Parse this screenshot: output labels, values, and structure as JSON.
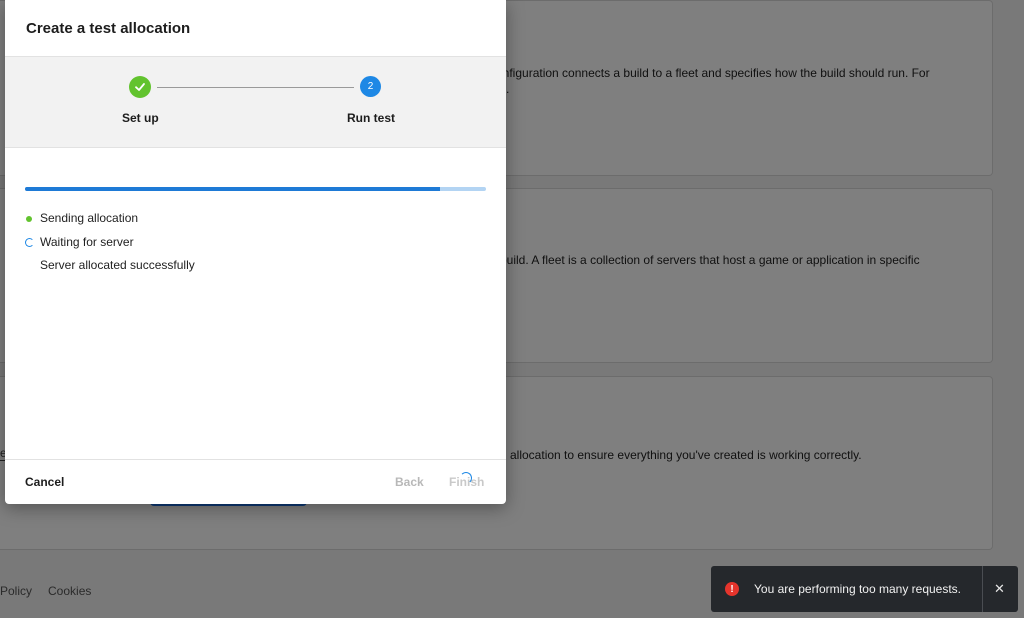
{
  "background": {
    "card1_desc": "onfiguration connects a build to a fleet and specifies how the build should run. For",
    "card1_desc2": ".",
    "card2_desc": "ur build. A fleet is a collection of servers that host a game or application in specific",
    "card3_desc": "allocation to ensure everything you've created is working correctly.",
    "card3_left_mark": "e",
    "footer_policy": "Policy",
    "footer_cookies": "Cookies"
  },
  "modal": {
    "title": "Create a test allocation",
    "steps": [
      {
        "label": "Set up",
        "state": "complete",
        "icon": "check-icon"
      },
      {
        "label": "Run test",
        "state": "active",
        "number": "2"
      }
    ],
    "progress_percent": 90,
    "status_items": [
      {
        "text": "Sending allocation",
        "state": "done",
        "icon": "green-dot-icon"
      },
      {
        "text": "Waiting for server",
        "state": "in-progress",
        "icon": "spinner-icon"
      },
      {
        "text": "Server allocated successfully",
        "state": "pending"
      }
    ],
    "footer": {
      "cancel_label": "Cancel",
      "back_label": "Back",
      "finish_label": "Finish"
    }
  },
  "toast": {
    "message": "You are performing too many requests.",
    "icon": "error-icon",
    "close_icon": "close-icon"
  },
  "colors": {
    "success": "#62c32e",
    "accent": "#1e88e5",
    "error": "#e5342c",
    "toast_bg": "#25282c"
  }
}
